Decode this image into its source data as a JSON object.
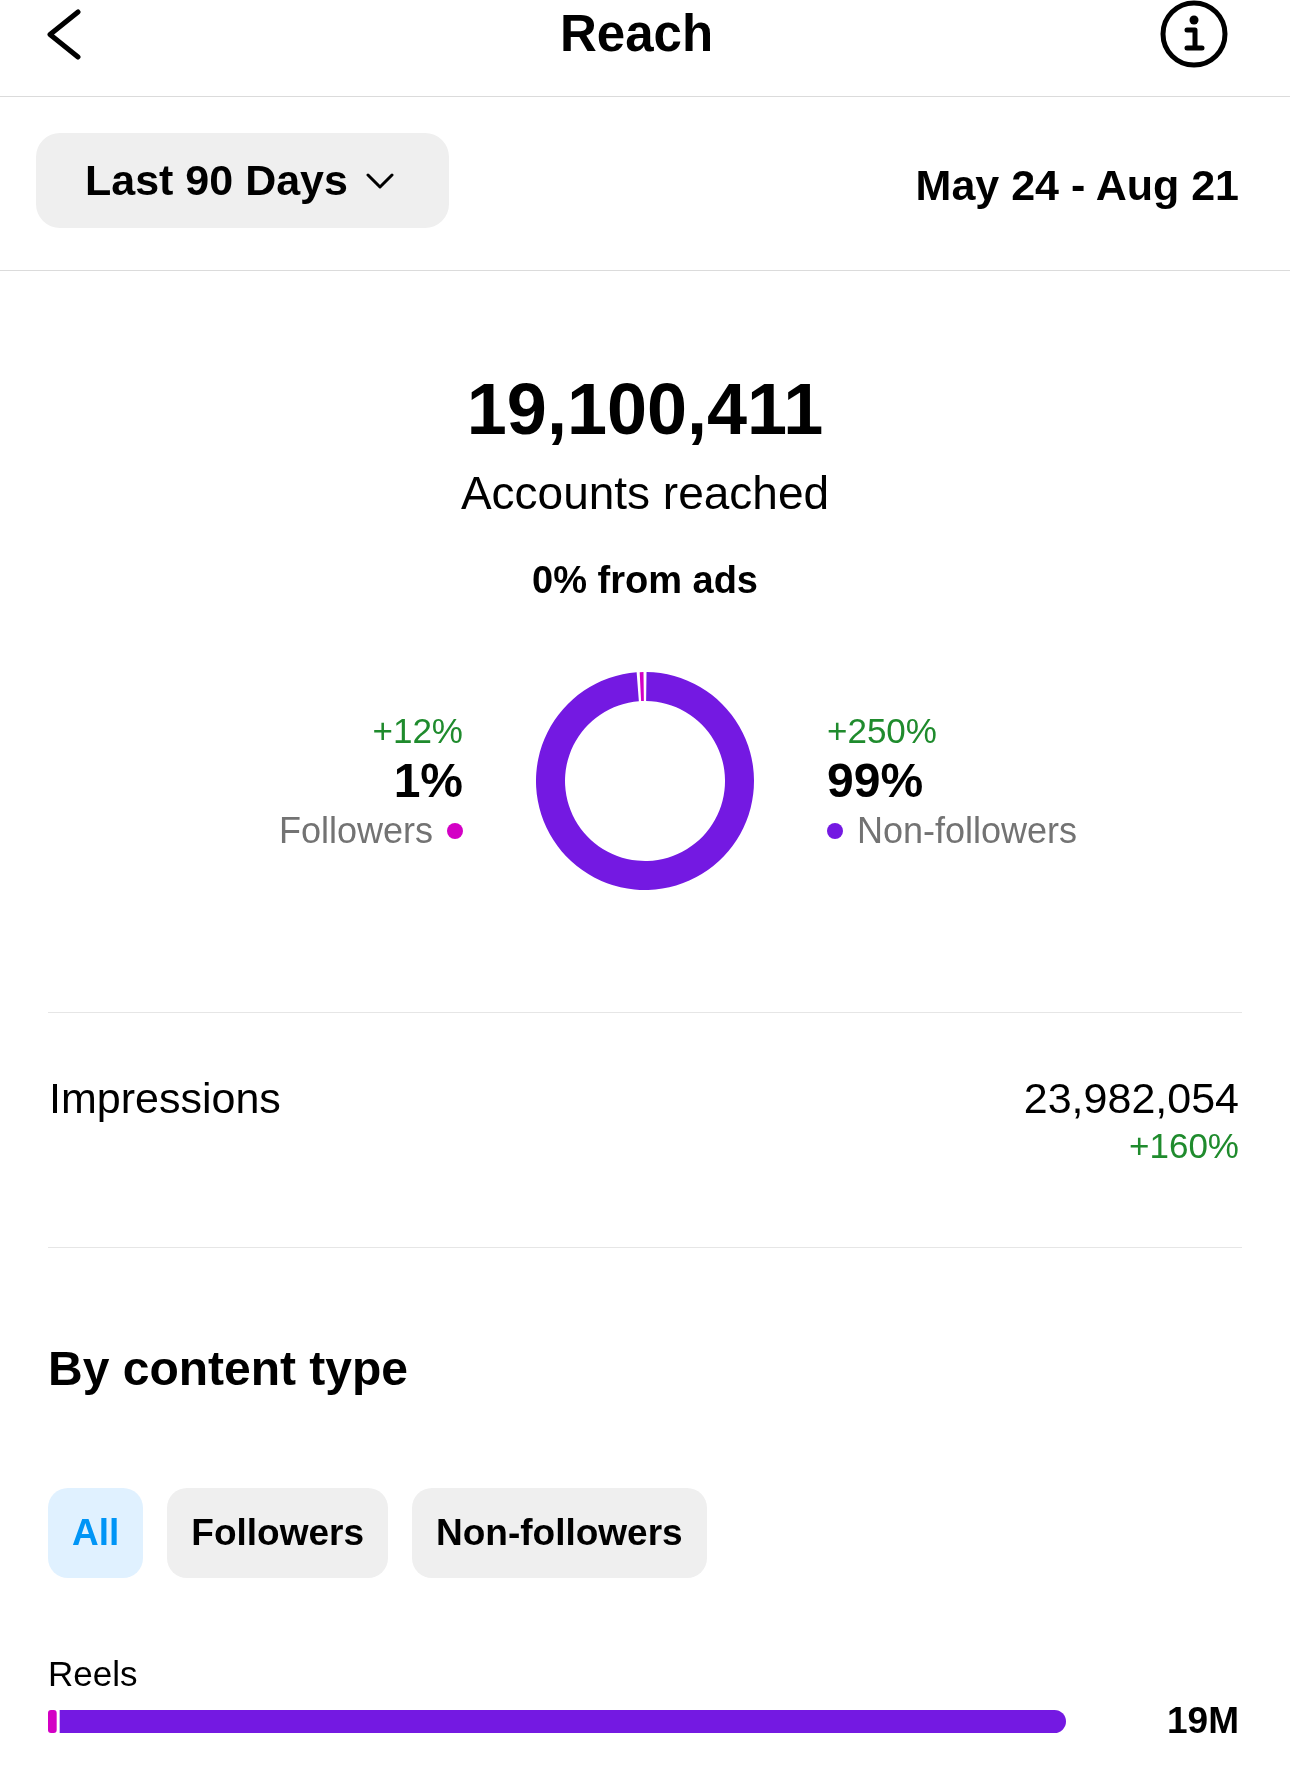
{
  "header": {
    "title": "Reach"
  },
  "period": {
    "dropdown": "Last 90 Days",
    "date_range": "May 24 - Aug 21"
  },
  "reach": {
    "total": "19,100,411",
    "caption": "Accounts reached",
    "ads_share": "0% from ads",
    "audience": [
      {
        "label": "Followers",
        "share": "1%",
        "change": "+12%",
        "color": "#d300c5"
      },
      {
        "label": "Non-followers",
        "share": "99%",
        "change": "+250%",
        "color": "#7419e2"
      }
    ],
    "chart_data": {
      "type": "donut",
      "values": [
        1,
        99
      ]
    }
  },
  "impressions": {
    "label": "Impressions",
    "value": "23,982,054",
    "change": "+160%"
  },
  "content_type": {
    "title": "By content type",
    "filters": [
      {
        "label": "All",
        "selected": true
      },
      {
        "label": "Followers",
        "selected": false
      },
      {
        "label": "Non-followers",
        "selected": false
      }
    ],
    "rows": [
      {
        "label": "Reels",
        "value": "19M"
      }
    ]
  }
}
